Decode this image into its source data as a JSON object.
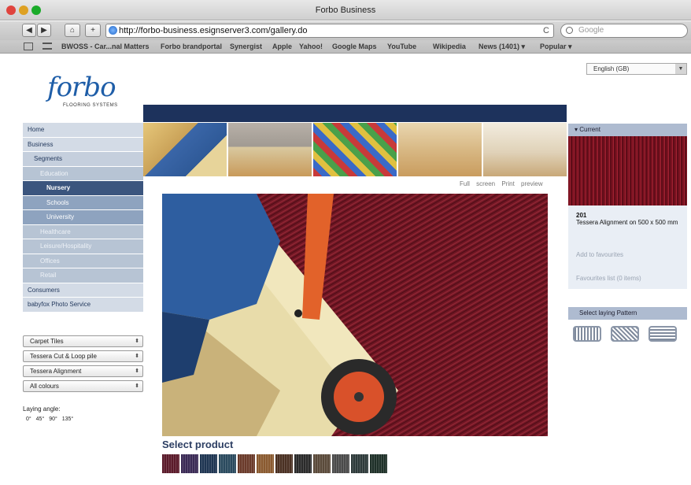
{
  "window": {
    "title": "Forbo Business"
  },
  "toolbar": {
    "back": "◀",
    "forward": "▶",
    "home": "⌂",
    "add": "+",
    "url": "http://forbo-business.esignserver3.com/gallery.do",
    "reload": "C",
    "search_placeholder": "Google"
  },
  "bookmarks": [
    "BWOSS - Car...nal Matters",
    "Forbo brandportal",
    "Synergist",
    "Apple",
    "Yahoo!",
    "Google Maps",
    "YouTube",
    "Wikipedia",
    "News (1401) ▾",
    "Popular ▾"
  ],
  "header": {
    "logo": "forbo",
    "logo_sub": "FLOORING SYSTEMS",
    "language": "English (GB)"
  },
  "nav": [
    {
      "label": "Home",
      "level": 0
    },
    {
      "label": "Business",
      "level": 0
    },
    {
      "label": "Segments",
      "level": 1
    },
    {
      "label": "Education",
      "level": 2
    },
    {
      "label": "Nursery",
      "level": 3,
      "active": true
    },
    {
      "label": "Schools",
      "level": 3
    },
    {
      "label": "University",
      "level": 3
    },
    {
      "label": "Healthcare",
      "level": 2
    },
    {
      "label": "Leisure/Hospitality",
      "level": 2
    },
    {
      "label": "Offices",
      "level": 2
    },
    {
      "label": "Retail",
      "level": 2
    },
    {
      "label": "Consumers",
      "level": 0
    },
    {
      "label": "babyfox Photo Service",
      "level": 0
    }
  ],
  "filters": {
    "selects": [
      "Carpet Tiles",
      "Tessera Cut & Loop pile",
      "Tessera Alignment",
      "All colours"
    ],
    "laying_label": "Laying angle:",
    "angles": [
      "0°",
      "45°",
      "90°",
      "135°"
    ]
  },
  "gallery": {
    "full_screen": "Full screen",
    "print_preview": "Print preview",
    "select_product": "Select product",
    "swatch_colors": [
      "#5a1a2a",
      "#3a2a55",
      "#1e3552",
      "#2a4a5e",
      "#6a3a2a",
      "#8a5a30",
      "#4a3022",
      "#2a2a2a",
      "#5a4a3a",
      "#4a4a4a",
      "#2e3a3a",
      "#1e3028"
    ]
  },
  "current": {
    "heading": "Current",
    "number": "201",
    "name": "Tessera Alignment on 500 x 500 mm",
    "add_favourites": "Add to favourites",
    "favourites": "Favourites list (0 items)"
  },
  "pattern": {
    "heading": "Select laying Pattern"
  }
}
